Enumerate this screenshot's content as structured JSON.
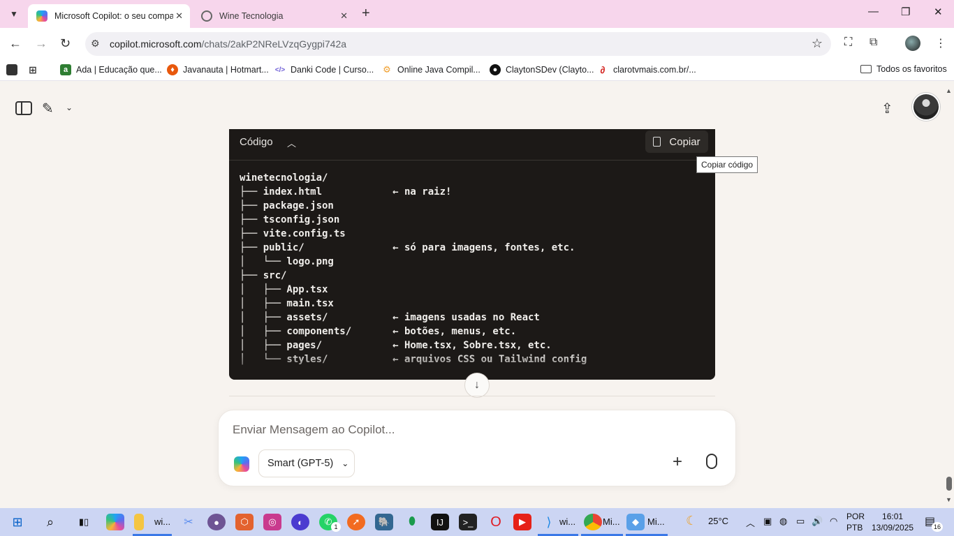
{
  "browser": {
    "tabs": [
      {
        "title": "Microsoft Copilot: o seu compa",
        "active": true
      },
      {
        "title": "Wine Tecnologia",
        "active": false
      }
    ],
    "url": {
      "host": "copilot.microsoft.com",
      "path": "/chats/2akP2NReLVzqGygpi742a"
    },
    "bookmarks": [
      {
        "label": "Ada | Educação que...",
        "color": "#2e7d32",
        "glyph": "a"
      },
      {
        "label": "Javanauta | Hotmart...",
        "color": "#e8580c",
        "glyph": "♦"
      },
      {
        "label": "Danki Code | Curso...",
        "color": "#6b5bd6",
        "glyph": "</>"
      },
      {
        "label": "Online Java Compil...",
        "color": "#f0a030",
        "glyph": "⚙"
      },
      {
        "label": "ClaytonSDev (Clayto...",
        "color": "#111111",
        "glyph": "●"
      },
      {
        "label": "clarotvmais.com.br/...",
        "color": "#d3201c",
        "glyph": "∂"
      }
    ],
    "all_bookmarks_label": "Todos os favoritos"
  },
  "code": {
    "language_label": "Código",
    "copy_label": "Copiar",
    "copy_tooltip": "Copiar código",
    "text": "winetecnologia/\n├── index.html            ← na raiz!\n├── package.json\n├── tsconfig.json\n├── vite.config.ts\n├── public/               ← só para imagens, fontes, etc.\n│   └── logo.png\n├── src/\n│   ├── App.tsx\n│   ├── main.tsx\n│   ├── assets/           ← imagens usadas no React\n│   ├── components/       ← botões, menus, etc.\n│   ├── pages/            ← Home.tsx, Sobre.tsx, etc.\n│   └── styles/           ← arquivos CSS ou Tailwind config"
  },
  "composer": {
    "placeholder": "Enviar Mensagem ao Copilot...",
    "model_label": "Smart (GPT-5)"
  },
  "taskbar": {
    "labels": [
      "wi...",
      "wi...",
      "Mi...",
      "Mi..."
    ],
    "weather": "25°C",
    "lang_top": "POR",
    "lang_bottom": "PTB",
    "time": "16:01",
    "date": "13/09/2025",
    "notification_count": "16",
    "whatsapp_badge": "1"
  }
}
